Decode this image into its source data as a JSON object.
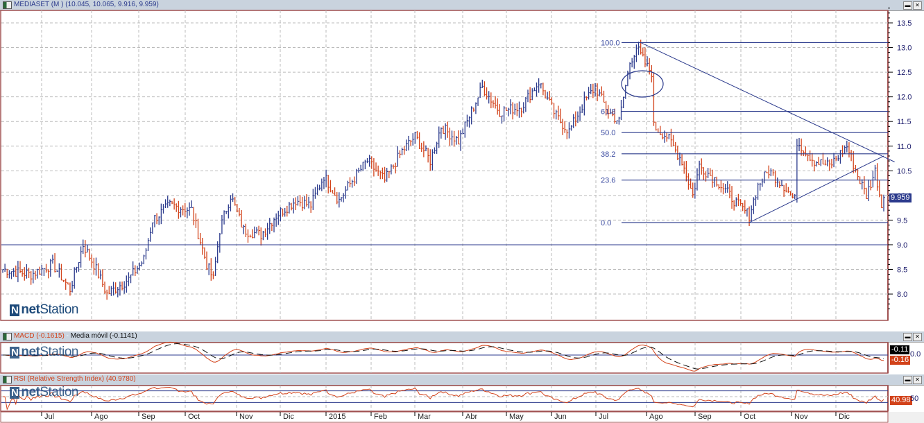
{
  "main_panel": {
    "title": "MEDIASET (M ) (10.045, 10.065, 9.916, 9.959)",
    "last_price_badge": "9.959"
  },
  "macd_panel": {
    "title_macd": "MACD (-0.1615)",
    "title_sep": " - ",
    "title_ma": "Media móvil (-0.1141)",
    "badge_signal": "-0.11",
    "badge_macd": "-0.16",
    "axis_label": "0.0"
  },
  "rsi_panel": {
    "title": "RSI (Relative Strength Index) (40.9780)",
    "badge": "40.98",
    "axis_label": "50"
  },
  "logo": {
    "prefix": "net",
    "suffix": "Station"
  },
  "window_buttons": {
    "minimize": "▬",
    "close": "✕"
  },
  "colors": {
    "up": "#2b3a8c",
    "down": "#d2421a",
    "line": "#2b3a8c",
    "macd": "#d2421a",
    "signal": "#111111",
    "border": "#a05050"
  },
  "chart_data": {
    "type": "ohlc",
    "title": "MEDIASET (M )",
    "y_ticks": [
      "13.5",
      "13.0",
      "12.5",
      "12.0",
      "11.5",
      "11.0",
      "10.5",
      "10.0",
      "9.5",
      "9.0",
      "8.5",
      "8.0"
    ],
    "ylim": [
      7.6,
      13.85
    ],
    "x_months": [
      "Jul",
      "Ago",
      "Sep",
      "Oct",
      "Nov",
      "Dic",
      "2015",
      "Feb",
      "Mar",
      "Abr",
      "May",
      "Jun",
      "Jul",
      "Ago",
      "Sep",
      "Oct",
      "Nov",
      "Dic"
    ],
    "bar_count": 407,
    "close_anchors": [
      [
        0,
        8.5
      ],
      [
        13,
        8.4
      ],
      [
        23,
        8.6
      ],
      [
        31,
        8.1
      ],
      [
        37,
        9.0
      ],
      [
        42,
        8.6
      ],
      [
        48,
        8.0
      ],
      [
        58,
        8.3
      ],
      [
        65,
        8.7
      ],
      [
        69,
        9.5
      ],
      [
        77,
        9.8
      ],
      [
        87,
        9.7
      ],
      [
        94,
        8.6
      ],
      [
        97,
        8.3
      ],
      [
        100,
        9.3
      ],
      [
        105,
        10.0
      ],
      [
        111,
        9.3
      ],
      [
        119,
        9.2
      ],
      [
        126,
        9.6
      ],
      [
        135,
        9.9
      ],
      [
        142,
        9.8
      ],
      [
        148,
        10.4
      ],
      [
        155,
        9.9
      ],
      [
        161,
        10.3
      ],
      [
        168,
        10.7
      ],
      [
        176,
        10.3
      ],
      [
        184,
        10.9
      ],
      [
        190,
        11.2
      ],
      [
        197,
        10.7
      ],
      [
        202,
        11.4
      ],
      [
        210,
        11.1
      ],
      [
        216,
        11.7
      ],
      [
        221,
        12.2
      ],
      [
        229,
        11.7
      ],
      [
        239,
        11.8
      ],
      [
        247,
        12.3
      ],
      [
        255,
        11.6
      ],
      [
        261,
        11.3
      ],
      [
        268,
        11.9
      ],
      [
        273,
        12.2
      ],
      [
        279,
        11.7
      ],
      [
        284,
        11.5
      ],
      [
        289,
        12.7
      ],
      [
        292,
        13.0
      ],
      [
        297,
        12.6
      ],
      [
        299,
        12.5
      ],
      [
        300,
        11.4
      ],
      [
        306,
        11.2
      ],
      [
        313,
        10.7
      ],
      [
        318,
        10.0
      ],
      [
        321,
        10.6
      ],
      [
        329,
        10.3
      ],
      [
        339,
        9.8
      ],
      [
        344,
        9.6
      ],
      [
        348,
        10.2
      ],
      [
        353,
        10.5
      ],
      [
        360,
        10.2
      ],
      [
        365,
        9.9
      ],
      [
        366,
        11.1
      ],
      [
        374,
        10.7
      ],
      [
        381,
        10.6
      ],
      [
        389,
        11.0
      ],
      [
        394,
        10.4
      ],
      [
        398,
        10.0
      ],
      [
        402,
        10.5
      ],
      [
        405,
        9.8
      ],
      [
        406,
        9.959
      ]
    ],
    "support_line": 9.0,
    "fibonacci": {
      "low": 9.45,
      "high": 13.1,
      "levels": [
        {
          "label": "100.0",
          "ratio": 1.0
        },
        {
          "label": "61.8",
          "ratio": 0.618
        },
        {
          "label": "50.0",
          "ratio": 0.5
        },
        {
          "label": "38.2",
          "ratio": 0.382
        },
        {
          "label": "23.6",
          "ratio": 0.236
        },
        {
          "label": "0.0",
          "ratio": 0.0
        }
      ]
    },
    "trendlines": [
      {
        "from": [
          294,
          13.1
        ],
        "to": [
          411,
          10.68
        ]
      },
      {
        "from": [
          344,
          9.45
        ],
        "to": [
          406,
          10.8
        ]
      }
    ],
    "macd": {
      "value": -0.1615,
      "signal": -0.1141
    },
    "rsi": {
      "value": 40.978,
      "upper": 70,
      "lower": 30
    }
  }
}
